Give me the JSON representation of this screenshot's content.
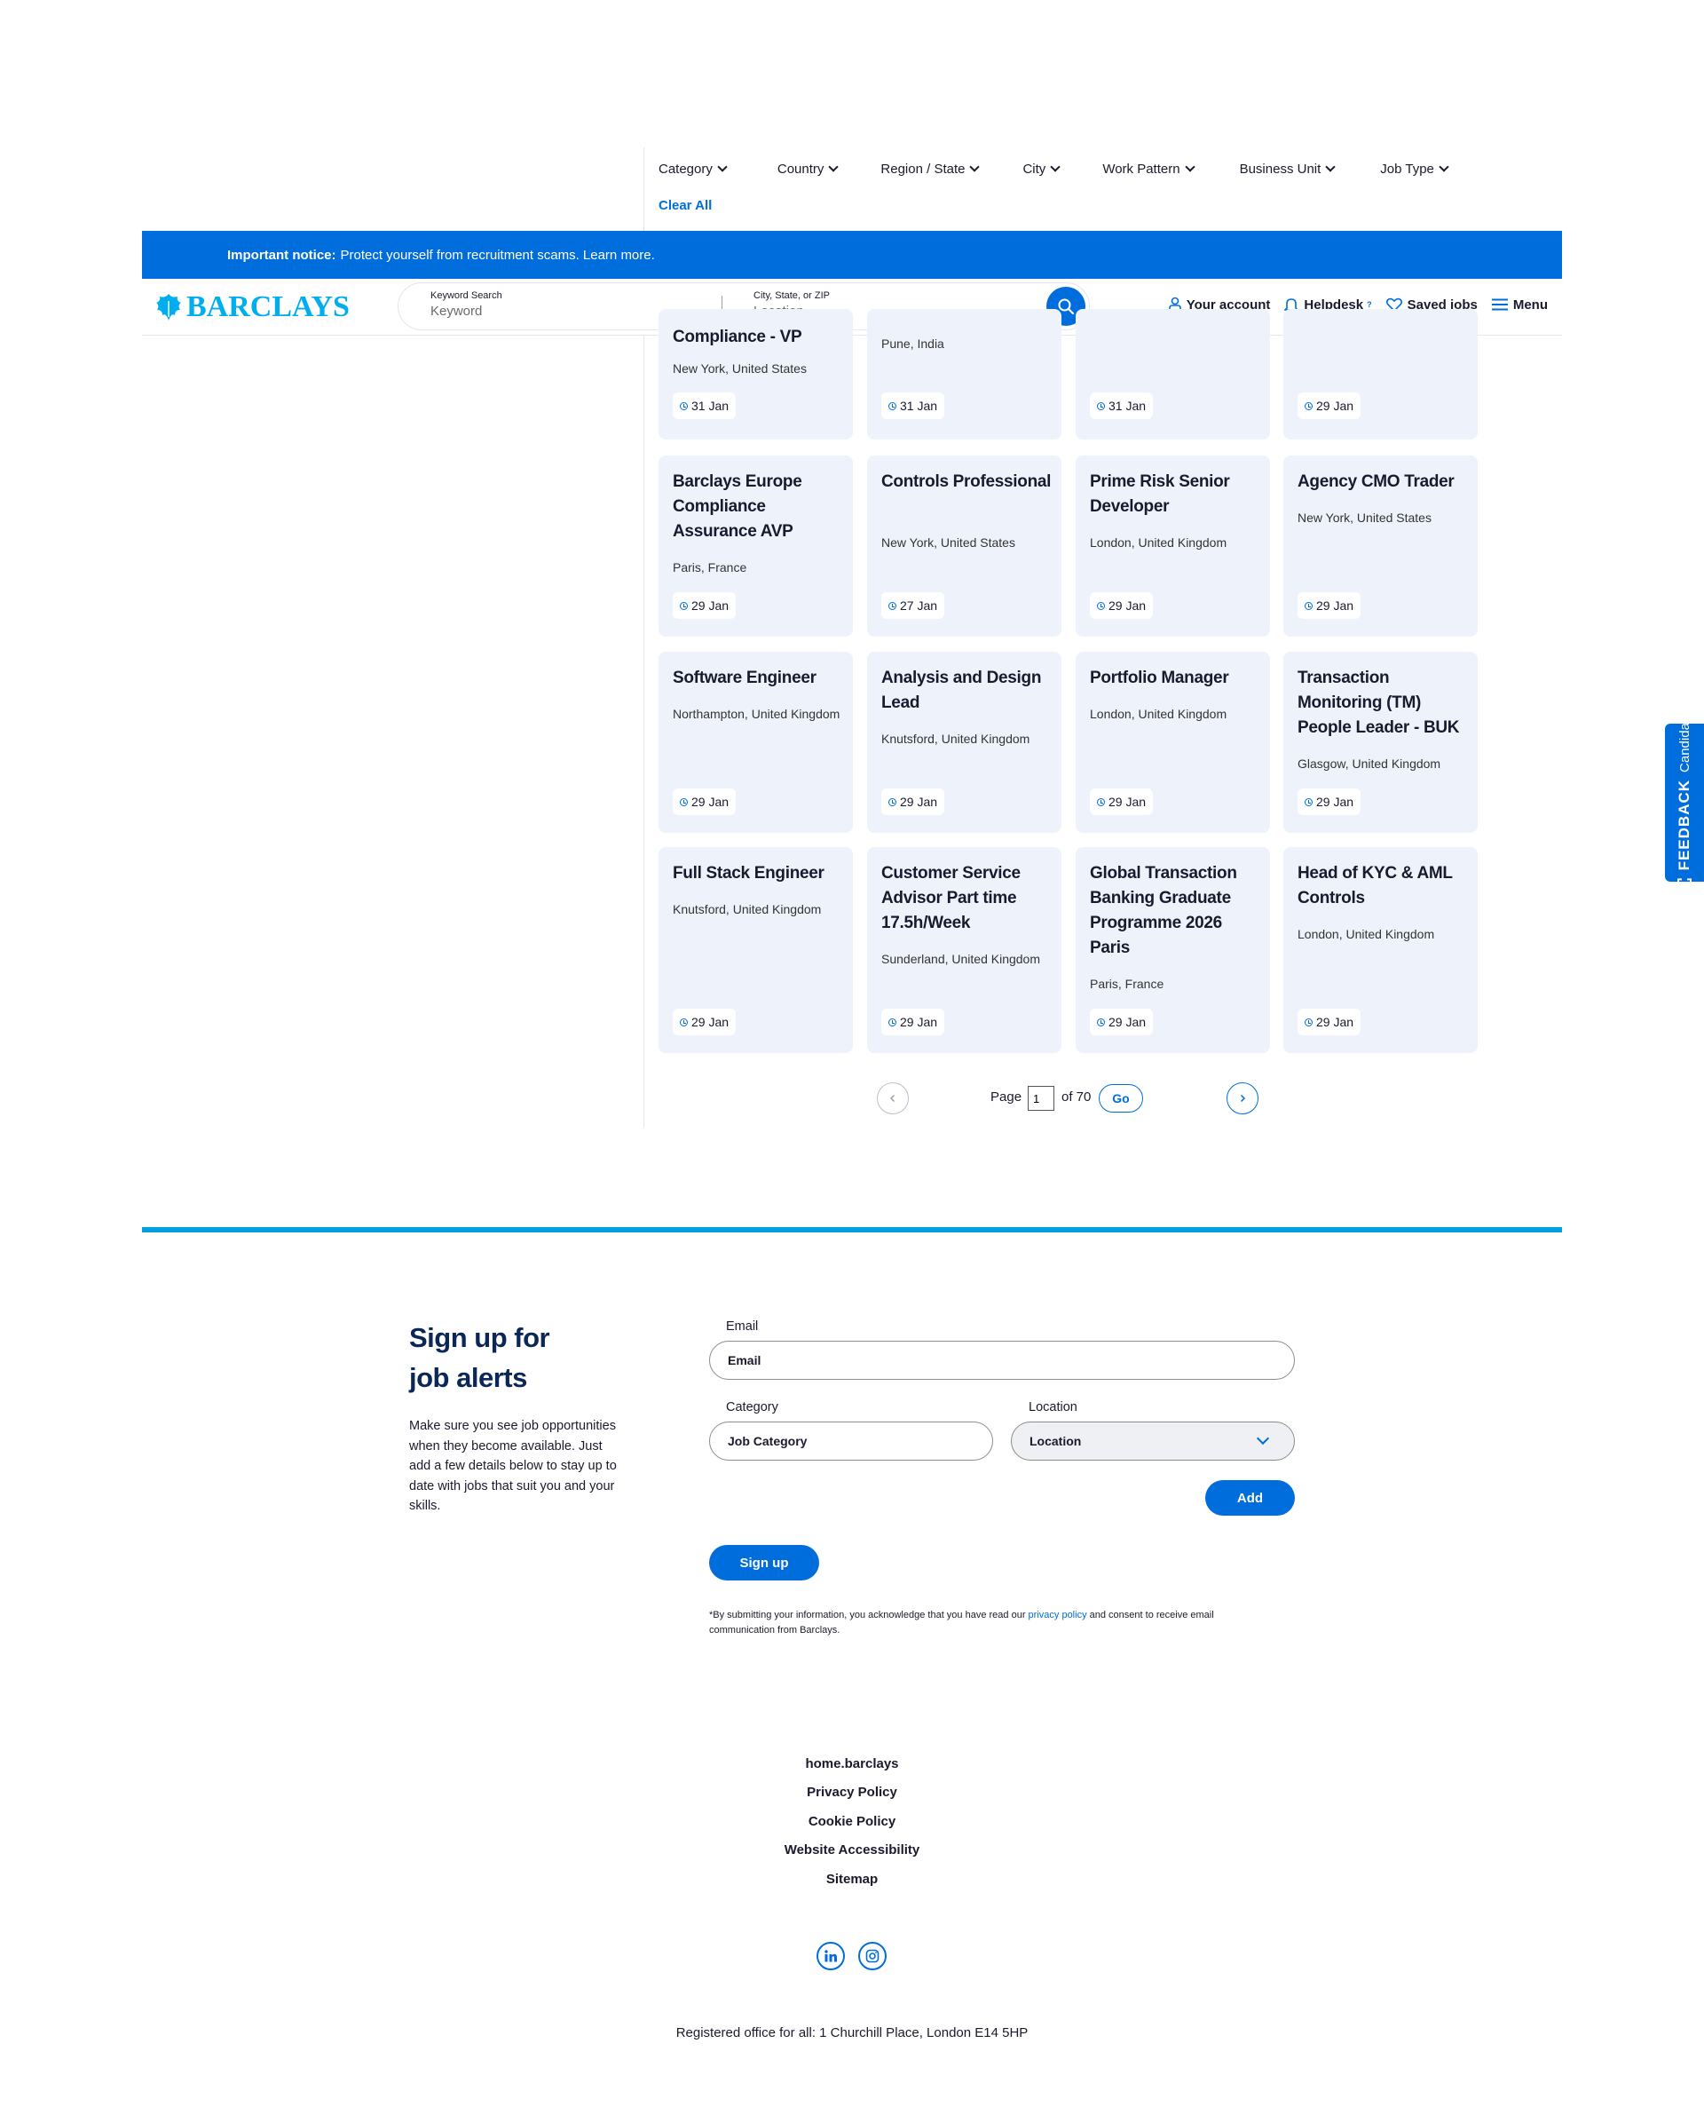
{
  "filters": {
    "items": [
      "Category",
      "Country",
      "Region / State",
      "City",
      "Work Pattern",
      "Business Unit",
      "Job Type"
    ],
    "clear_all": "Clear All"
  },
  "notice": {
    "bold": "Important notice:",
    "text": "Protect yourself from recruitment scams. Learn more."
  },
  "header": {
    "logo_text": "BARCLAYS",
    "keyword_label": "Keyword Search",
    "keyword_placeholder": "Keyword",
    "location_label": "City, State, or ZIP",
    "location_placeholder": "Location",
    "account": "Your account",
    "helpdesk": "Helpdesk",
    "helpdesk_sup": "?",
    "saved_jobs": "Saved jobs",
    "menu": "Menu"
  },
  "jobs": [
    {
      "title": "Compliance - VP",
      "location": "New York, United States",
      "date": "31 Jan"
    },
    {
      "title": "",
      "location": "Pune, India",
      "date": "31 Jan"
    },
    {
      "title": "",
      "location": "",
      "date": "31 Jan"
    },
    {
      "title": "",
      "location": "",
      "date": "29 Jan"
    },
    {
      "title": "Barclays Europe Compliance Assurance AVP",
      "location": "Paris, France",
      "date": "29 Jan"
    },
    {
      "title": "Controls Professional",
      "location": "New York, United States",
      "date": "27 Jan"
    },
    {
      "title": "Prime Risk Senior Developer",
      "location": "London, United Kingdom",
      "date": "29 Jan"
    },
    {
      "title": "Agency CMO Trader",
      "location": "New York, United States",
      "date": "29 Jan"
    },
    {
      "title": "Software Engineer",
      "location": "Northampton, United Kingdom",
      "date": "29 Jan"
    },
    {
      "title": "Analysis and Design Lead",
      "location": "Knutsford, United Kingdom",
      "date": "29 Jan"
    },
    {
      "title": "Portfolio Manager",
      "location": "London, United Kingdom",
      "date": "29 Jan"
    },
    {
      "title": "Transaction Monitoring (TM) People Leader - BUK",
      "location": "Glasgow, United Kingdom",
      "date": "29 Jan"
    },
    {
      "title": "Full Stack Engineer",
      "location": "Knutsford, United Kingdom",
      "date": "29 Jan"
    },
    {
      "title": "Customer Service Advisor Part time 17.5h/Week",
      "location": "Sunderland, United Kingdom",
      "date": "29 Jan"
    },
    {
      "title": "Global Transaction Banking Graduate Programme 2026 Paris",
      "location": "Paris, France",
      "date": "29 Jan"
    },
    {
      "title": "Head of KYC & AML Controls",
      "location": "London, United Kingdom",
      "date": "29 Jan"
    }
  ],
  "pagination": {
    "page_label": "Page",
    "current": "1",
    "of_label": "of 70",
    "go": "Go",
    "prev_icon": "chevron-left-icon",
    "next_icon": "chevron-right-icon"
  },
  "feedback": {
    "line1": "Candidate",
    "line2": "FEEDBACK"
  },
  "alerts": {
    "title_line1": "Sign up for",
    "title_line2": "job alerts",
    "description": "Make sure you see job opportunities when they become available. Just add a few details below to stay up to date with jobs that suit you and your skills.",
    "email_label": "Email",
    "email_placeholder": "Email",
    "category_label": "Category",
    "category_placeholder": "Job Category",
    "location_label": "Location",
    "location_value": "Location",
    "add": "Add",
    "sign_up": "Sign up",
    "disclaimer_before": "*By submitting your information, you acknowledge that you have read our",
    "disclaimer_link": "privacy policy",
    "disclaimer_after": "and consent to receive email communication from Barclays."
  },
  "footer": {
    "links": [
      "home.barclays",
      "Privacy Policy",
      "Cookie Policy",
      "Website Accessibility",
      "Sitemap"
    ],
    "social": [
      "linkedin-icon",
      "instagram-icon"
    ],
    "registered": "Registered office for all: 1 Churchill Place, London E14 5HP"
  },
  "colors": {
    "brand_blue": "#006ddd",
    "logo_cyan": "#00aeef",
    "card_bg": "#eef3fb",
    "divider": "#00a0e0"
  }
}
